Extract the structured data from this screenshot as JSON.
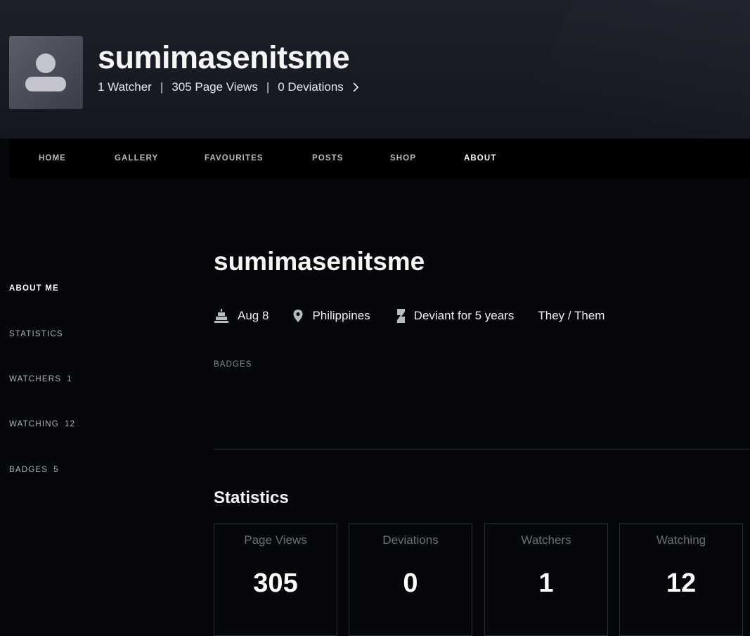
{
  "profile": {
    "username": "sumimasenitsme",
    "stats_line": {
      "watchers": "1 Watcher",
      "page_views": "305 Page Views",
      "deviations": "0 Deviations",
      "separator": "|"
    }
  },
  "nav": {
    "items": [
      {
        "label": "HOME"
      },
      {
        "label": "GALLERY"
      },
      {
        "label": "FAVOURITES"
      },
      {
        "label": "POSTS"
      },
      {
        "label": "SHOP"
      },
      {
        "label": "ABOUT",
        "active": true
      }
    ]
  },
  "sidebar": {
    "items": [
      {
        "label": "ABOUT ME",
        "count": "",
        "active": true
      },
      {
        "label": "STATISTICS",
        "count": ""
      },
      {
        "label": "WATCHERS",
        "count": "1"
      },
      {
        "label": "WATCHING",
        "count": "12"
      },
      {
        "label": "BADGES",
        "count": "5"
      }
    ]
  },
  "about": {
    "name": "sumimasenitsme",
    "birthday": "Aug 8",
    "location": "Philippines",
    "deviant_for": "Deviant for 5 years",
    "pronouns": "They / Them",
    "badges_label": "BADGES"
  },
  "statistics": {
    "heading": "Statistics",
    "cards": [
      {
        "label": "Page Views",
        "value": "305"
      },
      {
        "label": "Deviations",
        "value": "0"
      },
      {
        "label": "Watchers",
        "value": "1"
      },
      {
        "label": "Watching",
        "value": "12"
      }
    ]
  },
  "icons": {
    "avatar": "default-user-icon",
    "chevron": "chevron-right-icon",
    "birthday": "cake-icon",
    "location": "location-pin-icon",
    "deviant": "deviantart-logo-icon"
  },
  "colors": {
    "background": "#06070b",
    "header": "#1d2029",
    "nav": "#000000",
    "card_border": "#2c2f37",
    "muted_text": "#6b6e77"
  }
}
